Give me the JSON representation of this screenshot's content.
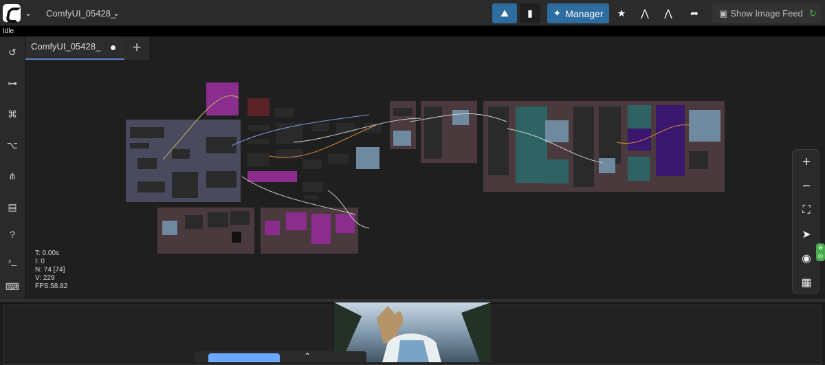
{
  "app": {
    "workflow_title": "ComfyUI_05428_",
    "status_text": "Idle"
  },
  "toolbar": {
    "manager_label": "Manager",
    "image_feed_label": "Show Image Feed"
  },
  "tabs": [
    {
      "label": "ComfyUI_05428_",
      "modified": true
    }
  ],
  "sidebar": {
    "icons": [
      "history-icon",
      "plugin-icon",
      "node-library-icon",
      "workflow-icon",
      "model-library-icon",
      "template-icon",
      "help-icon",
      "terminal-icon",
      "keyboard-icon"
    ]
  },
  "canvas_stats": {
    "t": "T: 0.00s",
    "i": "I: 0",
    "n": "N: 74 [74]",
    "v": "V: 229",
    "fps": "FPS:58.82"
  },
  "zoom_panel": {
    "icons": [
      "zoom-in-icon",
      "zoom-out-icon",
      "fit-view-icon",
      "navigate-icon",
      "visibility-icon",
      "minimap-icon"
    ]
  },
  "colors": {
    "accent": "#2d6da0",
    "run": "#6ba8ff",
    "tab_active": "#5d84c6",
    "magenta_node": "#8a2d8d",
    "teal_node": "#2f6363",
    "purple_node": "#3a176e"
  }
}
